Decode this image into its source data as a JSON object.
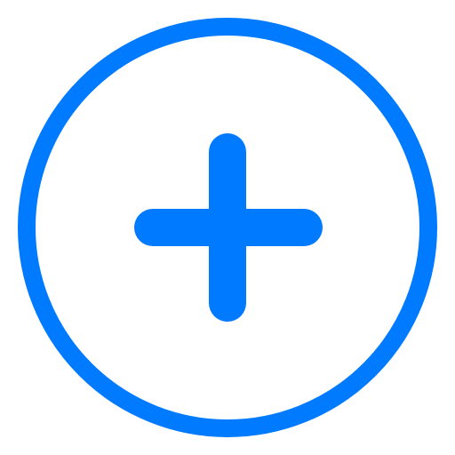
{
  "add_button": {
    "icon": "plus-circle-icon",
    "color": "#007AFF",
    "background": "#FFFFFF"
  }
}
